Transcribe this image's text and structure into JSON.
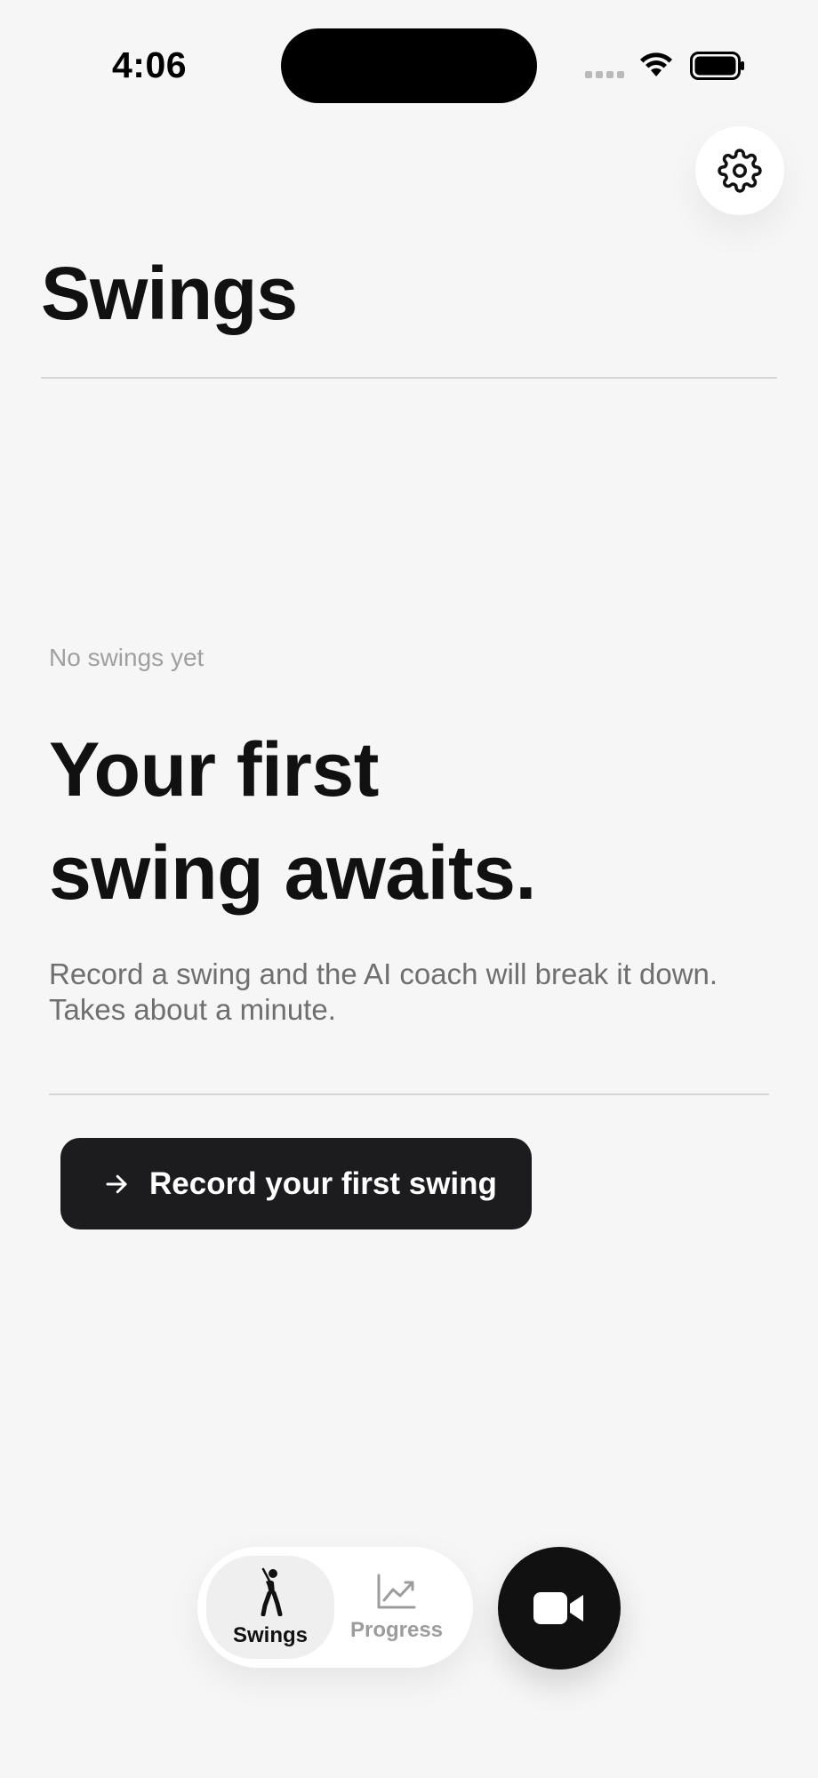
{
  "status_bar": {
    "time": "4:06"
  },
  "header": {
    "title": "Swings"
  },
  "empty_state": {
    "eyebrow": "No swings yet",
    "heading_line1": "Your first",
    "heading_line2": "swing awaits.",
    "description_line1": "Record a swing and the AI coach will break it down.",
    "description_line2": "Takes about a minute.",
    "cta_label": "Record your first swing"
  },
  "tabs": [
    {
      "label": "Swings",
      "icon": "golfer-icon",
      "active": true
    },
    {
      "label": "Progress",
      "icon": "chart-icon",
      "active": false
    }
  ],
  "icons": {
    "settings": "gear-icon",
    "record": "video-camera-icon",
    "cta": "arrow-right-icon"
  },
  "colors": {
    "background": "#f6f6f6",
    "primary": "#1c1c1e",
    "muted_text": "#6f6f6f",
    "inactive_tab": "#9c9c9c"
  }
}
